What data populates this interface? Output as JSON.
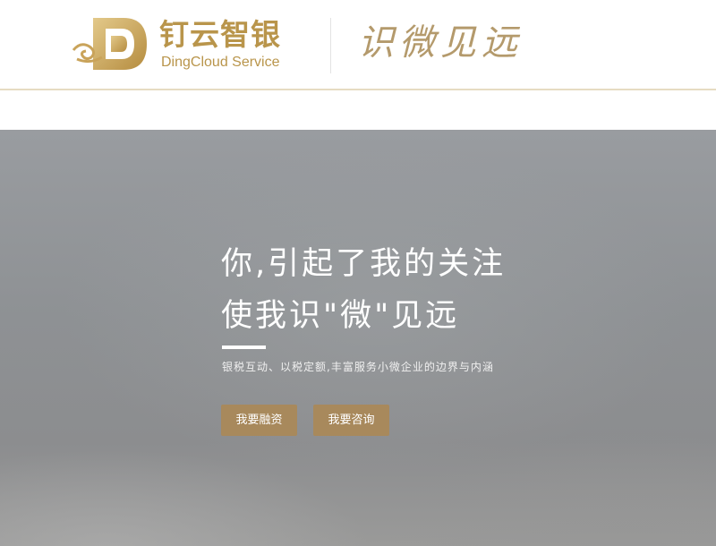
{
  "header": {
    "brand_cn": "钉云智银",
    "brand_en": "DingCloud Service",
    "slogan": "识微见远",
    "logo_icon": "dingcloud-d-logo-icon",
    "colors": {
      "brand_gold": "#b9954b",
      "slogan_gold": "#b49a6c",
      "rule": "#e6dcc2"
    }
  },
  "hero": {
    "title_line1": "你,引起了我的关注",
    "title_line2": "使我识\"微\"见远",
    "subtitle": "银税互动、以税定额,丰富服务小微企业的边界与内涵",
    "buttons": {
      "finance": "我要融资",
      "consult": "我要咨询"
    },
    "colors": {
      "button_bg": "#a8895c",
      "text": "#ffffff"
    }
  }
}
